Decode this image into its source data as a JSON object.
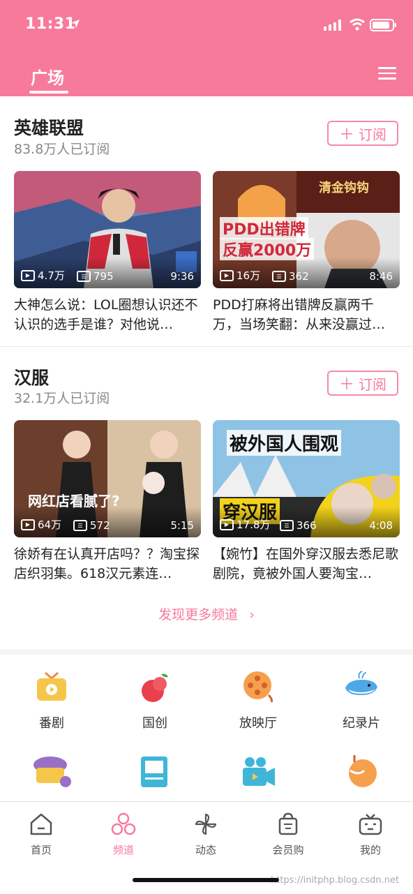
{
  "status": {
    "time": "11:31"
  },
  "header": {
    "tab_label": "广场"
  },
  "sections": [
    {
      "title": "英雄联盟",
      "subtitle": "83.8万人已订阅",
      "subscribe_label": "订阅",
      "cards": [
        {
          "views": "4.7万",
          "danmaku": "795",
          "duration": "9:36",
          "caption": "大神怎么说：LOL圈想认识还不认识的选手是谁？对他说…"
        },
        {
          "views": "16万",
          "danmaku": "362",
          "duration": "8:46",
          "caption": "PDD打麻将出错牌反赢两千万，当场笑翻：从来没赢过…",
          "overlay1": "PDD出错牌",
          "overlay2": "反赢2000万",
          "overlay_top": "清金钩钩"
        }
      ]
    },
    {
      "title": "汉服",
      "subtitle": "32.1万人已订阅",
      "subscribe_label": "订阅",
      "cards": [
        {
          "views": "64万",
          "danmaku": "572",
          "duration": "5:15",
          "caption": "徐娇有在认真开店吗？？淘宝探店织羽集。618汉元素连…",
          "overlay1": "网红店看腻了?"
        },
        {
          "views": "17.8万",
          "danmaku": "366",
          "duration": "4:08",
          "caption": "【婉竹】在国外穿汉服去悉尼歌剧院，竟被外国人要淘宝…",
          "overlay1": "被外国人围观",
          "overlay2": "穿汉服"
        }
      ]
    }
  ],
  "more_link": "发现更多频道",
  "categories": [
    {
      "label": "番剧",
      "icon": "tv-icon"
    },
    {
      "label": "国创",
      "icon": "fruit-icon"
    },
    {
      "label": "放映厅",
      "icon": "film-reel-icon"
    },
    {
      "label": "纪录片",
      "icon": "whale-icon"
    }
  ],
  "tabs": [
    {
      "label": "首页",
      "icon": "home-icon"
    },
    {
      "label": "频道",
      "icon": "channel-icon"
    },
    {
      "label": "动态",
      "icon": "pinwheel-icon"
    },
    {
      "label": "会员购",
      "icon": "shopping-bag-icon"
    },
    {
      "label": "我的",
      "icon": "tv-face-icon"
    }
  ],
  "watermark": "https://initphp.blog.csdn.net",
  "colors": {
    "accent": "#f77a9b",
    "text": "#222222",
    "subtext": "#888888"
  }
}
